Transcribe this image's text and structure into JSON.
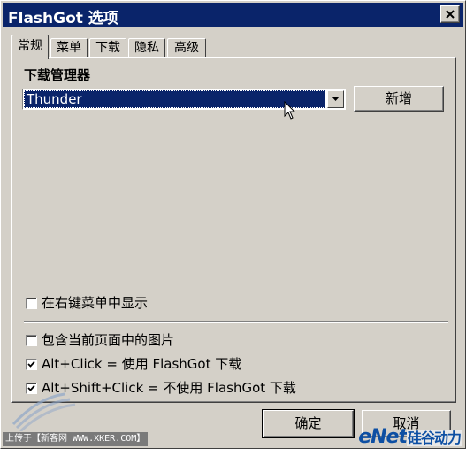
{
  "window": {
    "title": "FlashGot 选项"
  },
  "tabs": [
    {
      "label": "常规",
      "active": true
    },
    {
      "label": "菜单",
      "active": false
    },
    {
      "label": "下载",
      "active": false
    },
    {
      "label": "隐私",
      "active": false
    },
    {
      "label": "高级",
      "active": false
    }
  ],
  "general": {
    "download_manager_label": "下载管理器",
    "download_manager_value": "Thunder",
    "add_button": "新增",
    "checkboxes": [
      {
        "label": "在右键菜单中显示",
        "checked": false
      },
      {
        "label": "包含当前页面中的图片",
        "checked": false
      },
      {
        "label": "Alt+Click = 使用 FlashGot 下载",
        "checked": true
      },
      {
        "label": "Alt+Shift+Click = 不使用 FlashGot 下载",
        "checked": true
      }
    ]
  },
  "footer": {
    "ok_button": "确定",
    "cancel_button": "取消"
  },
  "watermarks": {
    "left": "上传于【新客网 WWW.XKER.COM】",
    "right_main": "eNet",
    "right_sub": "硅谷动力"
  },
  "colors": {
    "titlebar": "#0a246a",
    "face": "#d4d0c8",
    "selection": "#0a246a"
  }
}
